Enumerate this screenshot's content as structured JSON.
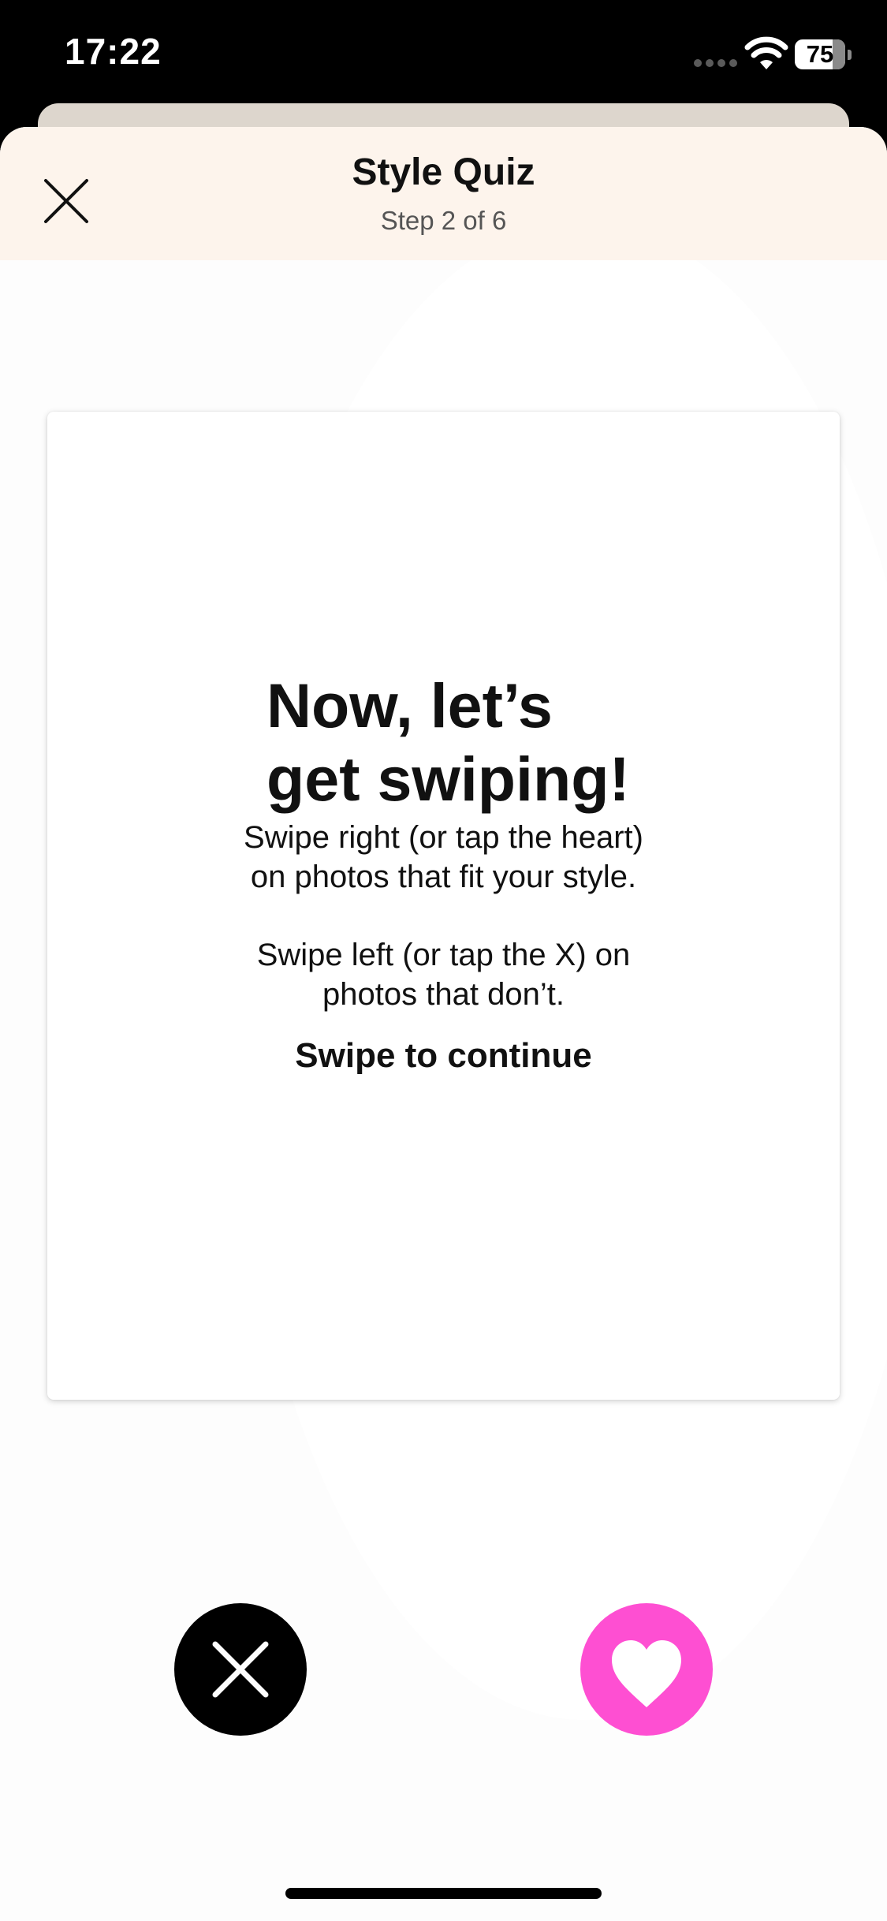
{
  "status_bar": {
    "time": "17:22",
    "battery": "75",
    "icons": [
      "signal-icon",
      "wifi-icon",
      "battery-icon"
    ]
  },
  "header": {
    "title": "Style Quiz",
    "subtitle": "Step 2 of 6",
    "close_icon": "close-icon"
  },
  "card": {
    "headline_lines": [
      "Now, let’s",
      "get swiping!"
    ],
    "paragraph_1_lines": [
      "Swipe right (or tap the heart)",
      "on photos that fit your style."
    ],
    "paragraph_2_lines": [
      "Swipe left (or tap the X) on",
      "photos that don’t."
    ],
    "cta": "Swipe to continue"
  },
  "actions": {
    "reject_icon": "x-icon",
    "like_icon": "heart-icon"
  },
  "colors": {
    "header_bg": "#fdf4ec",
    "back_sheet": "#ddd6cd",
    "like_button": "#fe4fd2",
    "reject_button": "#000000",
    "text_primary": "#111111",
    "text_secondary": "#555555"
  }
}
